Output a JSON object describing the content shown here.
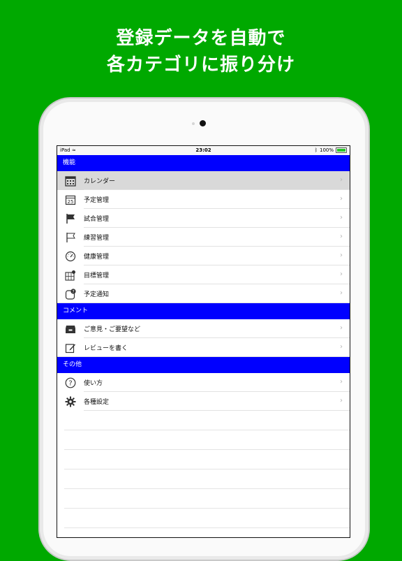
{
  "headline": {
    "line1": "登録データを自動で",
    "line2": "各カテゴリに振り分け"
  },
  "statusbar": {
    "device": "iPad",
    "time": "23:02",
    "battery": "100%"
  },
  "sections": [
    {
      "title": "機能",
      "items": [
        {
          "label": "カレンダー",
          "icon": "calendar-grid-icon",
          "selected": true
        },
        {
          "label": "予定管理",
          "icon": "calendar-date-icon"
        },
        {
          "label": "試合管理",
          "icon": "flag-filled-icon"
        },
        {
          "label": "練習管理",
          "icon": "flag-outline-icon"
        },
        {
          "label": "健康管理",
          "icon": "gauge-icon"
        },
        {
          "label": "目標管理",
          "icon": "map-pin-icon"
        },
        {
          "label": "予定通知",
          "icon": "notification-badge-icon"
        }
      ]
    },
    {
      "title": "コメント",
      "items": [
        {
          "label": "ご意見・ご要望など",
          "icon": "inbox-icon"
        },
        {
          "label": "レビューを書く",
          "icon": "compose-icon"
        }
      ]
    },
    {
      "title": "その他",
      "items": [
        {
          "label": "使い方",
          "icon": "help-icon"
        },
        {
          "label": "各種設定",
          "icon": "gear-icon"
        }
      ]
    }
  ],
  "calendar_day": "25",
  "badge_count": "7",
  "help_glyph": "?",
  "chevron_glyph": "›",
  "accent_color": "#0000ff",
  "background_color": "#00a900"
}
